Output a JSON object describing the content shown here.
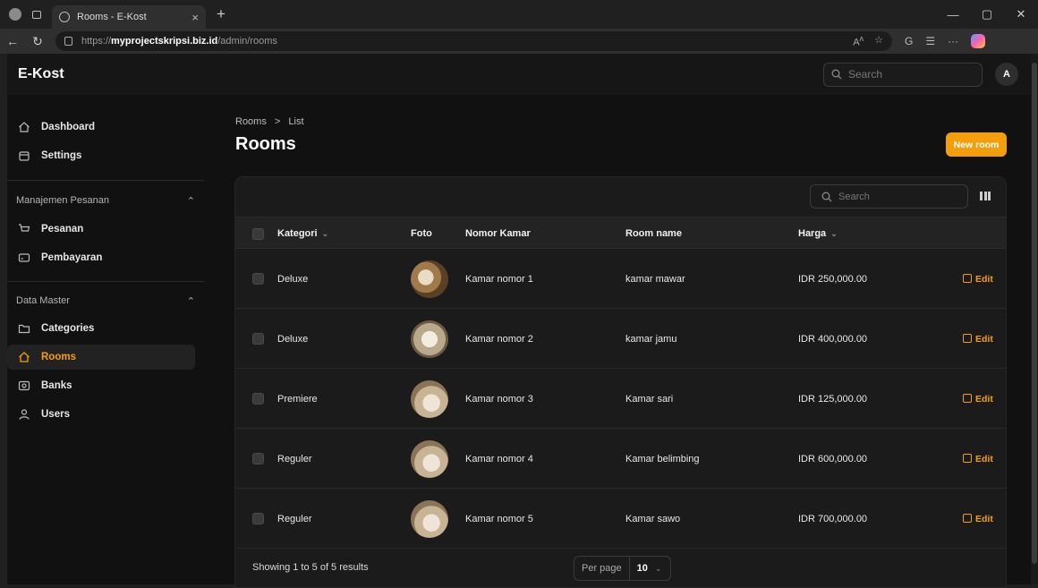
{
  "browser": {
    "tab_title": "Rooms - E-Kost",
    "new_tab": "+",
    "url_prefix": "https://",
    "url_host": "myprojectskripsi.biz.id",
    "url_path": "/admin/rooms",
    "window_controls": [
      "—",
      "▢",
      "✕"
    ]
  },
  "app": {
    "brand": "E-Kost",
    "search_placeholder": "Search",
    "avatar_initial": "A"
  },
  "sidebar": {
    "top_items": [
      {
        "label": "Dashboard",
        "icon": "home-icon"
      },
      {
        "label": "Settings",
        "icon": "layers-icon"
      }
    ],
    "groups": [
      {
        "label": "Manajemen Pesanan",
        "items": [
          {
            "label": "Pesanan",
            "icon": "cart-icon"
          },
          {
            "label": "Pembayaran",
            "icon": "card-icon"
          }
        ]
      },
      {
        "label": "Data Master",
        "items": [
          {
            "label": "Categories",
            "icon": "folder-icon"
          },
          {
            "label": "Rooms",
            "icon": "home-icon",
            "active": true
          },
          {
            "label": "Banks",
            "icon": "bank-icon"
          },
          {
            "label": "Users",
            "icon": "user-icon"
          }
        ]
      }
    ]
  },
  "page": {
    "breadcrumb_root": "Rooms",
    "breadcrumb_sep": ">",
    "breadcrumb_current": "List",
    "title": "Rooms",
    "new_button": "New room"
  },
  "table": {
    "search_placeholder": "Search",
    "columns": [
      "Kategori",
      "Foto",
      "Nomor Kamar",
      "Room name",
      "Harga"
    ],
    "rows": [
      {
        "kategori": "Deluxe",
        "nomor": "Kamar nomor 1",
        "name": "kamar mawar",
        "harga": "IDR 250,000.00",
        "edit": "Edit"
      },
      {
        "kategori": "Deluxe",
        "nomor": "Kamar nomor 2",
        "name": "kamar jamu",
        "harga": "IDR 400,000.00",
        "edit": "Edit"
      },
      {
        "kategori": "Premiere",
        "nomor": "Kamar nomor 3",
        "name": "Kamar sari",
        "harga": "IDR 125,000.00",
        "edit": "Edit"
      },
      {
        "kategori": "Reguler",
        "nomor": "Kamar nomor 4",
        "name": "Kamar belimbing",
        "harga": "IDR 600,000.00",
        "edit": "Edit"
      },
      {
        "kategori": "Reguler",
        "nomor": "Kamar nomor 5",
        "name": "Kamar sawo",
        "harga": "IDR 700,000.00",
        "edit": "Edit"
      }
    ],
    "showing": "Showing 1 to 5 of 5 results",
    "per_page_label": "Per page",
    "per_page_value": "10"
  },
  "colors": {
    "accent": "#f59e0b",
    "background": "#111111",
    "card": "#1b1b1b"
  }
}
